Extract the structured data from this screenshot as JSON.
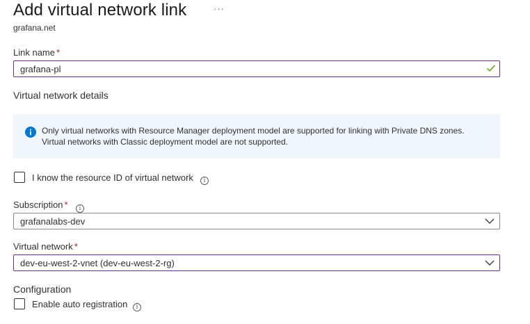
{
  "header": {
    "title": "Add virtual network link",
    "more_label": "···",
    "subtitle": "grafana.net"
  },
  "link_name": {
    "label": "Link name",
    "required_mark": "*",
    "value": "grafana-pl"
  },
  "details": {
    "heading": "Virtual network details"
  },
  "info_banner": {
    "line1": "Only virtual networks with Resource Manager deployment model are supported for linking with Private DNS zones.",
    "line2": "Virtual networks with Classic deployment model are not supported."
  },
  "resource_id_checkbox": {
    "label": "I know the resource ID of virtual network",
    "checked": false
  },
  "subscription": {
    "label": "Subscription",
    "required_mark": "*",
    "value": "grafanalabs-dev"
  },
  "virtual_network": {
    "label": "Virtual network",
    "required_mark": "*",
    "value": "dev-eu-west-2-vnet (dev-eu-west-2-rg)"
  },
  "configuration": {
    "heading": "Configuration",
    "auto_registration_label": "Enable auto registration",
    "auto_registration_checked": false
  },
  "icons": {
    "info_glyph": "i"
  },
  "colors": {
    "focus_border": "#6b2d87",
    "valid_check": "#57a300",
    "info_background": "#eff6fc",
    "info_icon": "#0078d4",
    "required": "#a4262c"
  }
}
